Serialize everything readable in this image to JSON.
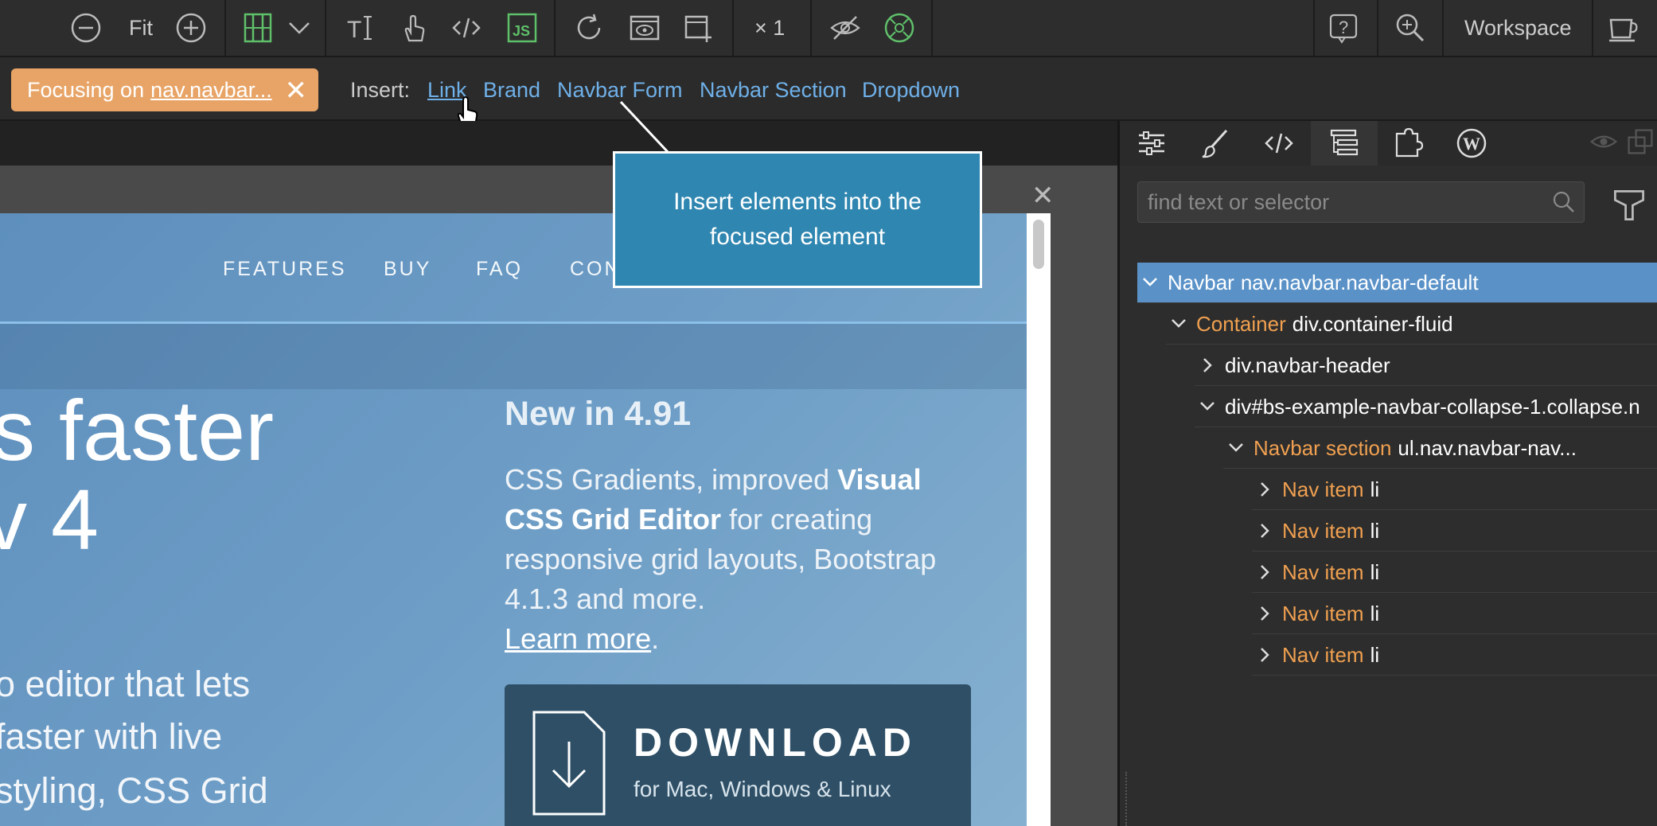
{
  "toolbar": {
    "zoom_label": "Fit",
    "multiplier_label": "× 1",
    "workspace_label": "Workspace",
    "icons": [
      "zoom-out",
      "zoom-in",
      "grid-editor",
      "dropdown-chevron",
      "text-tool",
      "interact-hand",
      "code",
      "js",
      "refresh",
      "preview",
      "add-page",
      "visibility",
      "responsive",
      "help",
      "zoom-search",
      "coffee"
    ]
  },
  "focus": {
    "label": "Focusing on",
    "selector": "nav.navbar...",
    "close": "✕"
  },
  "insert": {
    "label": "Insert:",
    "links": [
      "Link",
      "Brand",
      "Navbar Form",
      "Navbar Section",
      "Dropdown"
    ]
  },
  "tooltip": {
    "line1": "Insert elements into the",
    "line2": "focused element"
  },
  "canvas": {
    "close": "✕",
    "nav_items": [
      "FEATURES",
      "BUY",
      "FAQ",
      "CON"
    ],
    "hero_line1": "s faster",
    "hero_line2": "v 4",
    "body_lines": [
      "o editor that lets",
      "faster with live",
      "styling, CSS Grid"
    ],
    "new_title": "New in 4.91",
    "desc_part1": "CSS Gradients, improved ",
    "desc_bold1": "Visual",
    "desc_bold2": "CSS Grid Editor",
    "desc_part2": " for creating responsive grid layouts, Bootstrap 4.1.3 and more.",
    "learn_more": "Learn more",
    "desc_end": ".",
    "download_title": "DOWNLOAD",
    "download_sub": "for Mac, Windows & Linux"
  },
  "right_panel": {
    "search_placeholder": "find text or selector",
    "tabs": [
      "settings",
      "brush",
      "code",
      "tree",
      "plugins",
      "wordpress"
    ],
    "tree": [
      {
        "kind": "Navbar",
        "sel": "nav.navbar.navbar-default",
        "expanded": true
      },
      {
        "kind": "Container",
        "sel": "div.container-fluid",
        "expanded": true
      },
      {
        "kind": "",
        "sel": "div.navbar-header",
        "expanded": false
      },
      {
        "kind": "",
        "sel": "div#bs-example-navbar-collapse-1.collapse.n",
        "expanded": true
      },
      {
        "kind": "Navbar section",
        "sel": "ul.nav.navbar-nav...",
        "expanded": true
      },
      {
        "kind": "Nav item",
        "sel": "li",
        "expanded": false
      },
      {
        "kind": "Nav item",
        "sel": "li",
        "expanded": false
      },
      {
        "kind": "Nav item",
        "sel": "li",
        "expanded": false
      },
      {
        "kind": "Nav item",
        "sel": "li",
        "expanded": false
      },
      {
        "kind": "Nav item",
        "sel": "li",
        "expanded": false
      }
    ]
  },
  "colors": {
    "accent_orange": "#e8a466",
    "link_blue": "#6fb0e8",
    "tooltip_blue": "#2f86b0",
    "tree_selected": "#5a92c8",
    "icon_green": "#5fc06a"
  }
}
